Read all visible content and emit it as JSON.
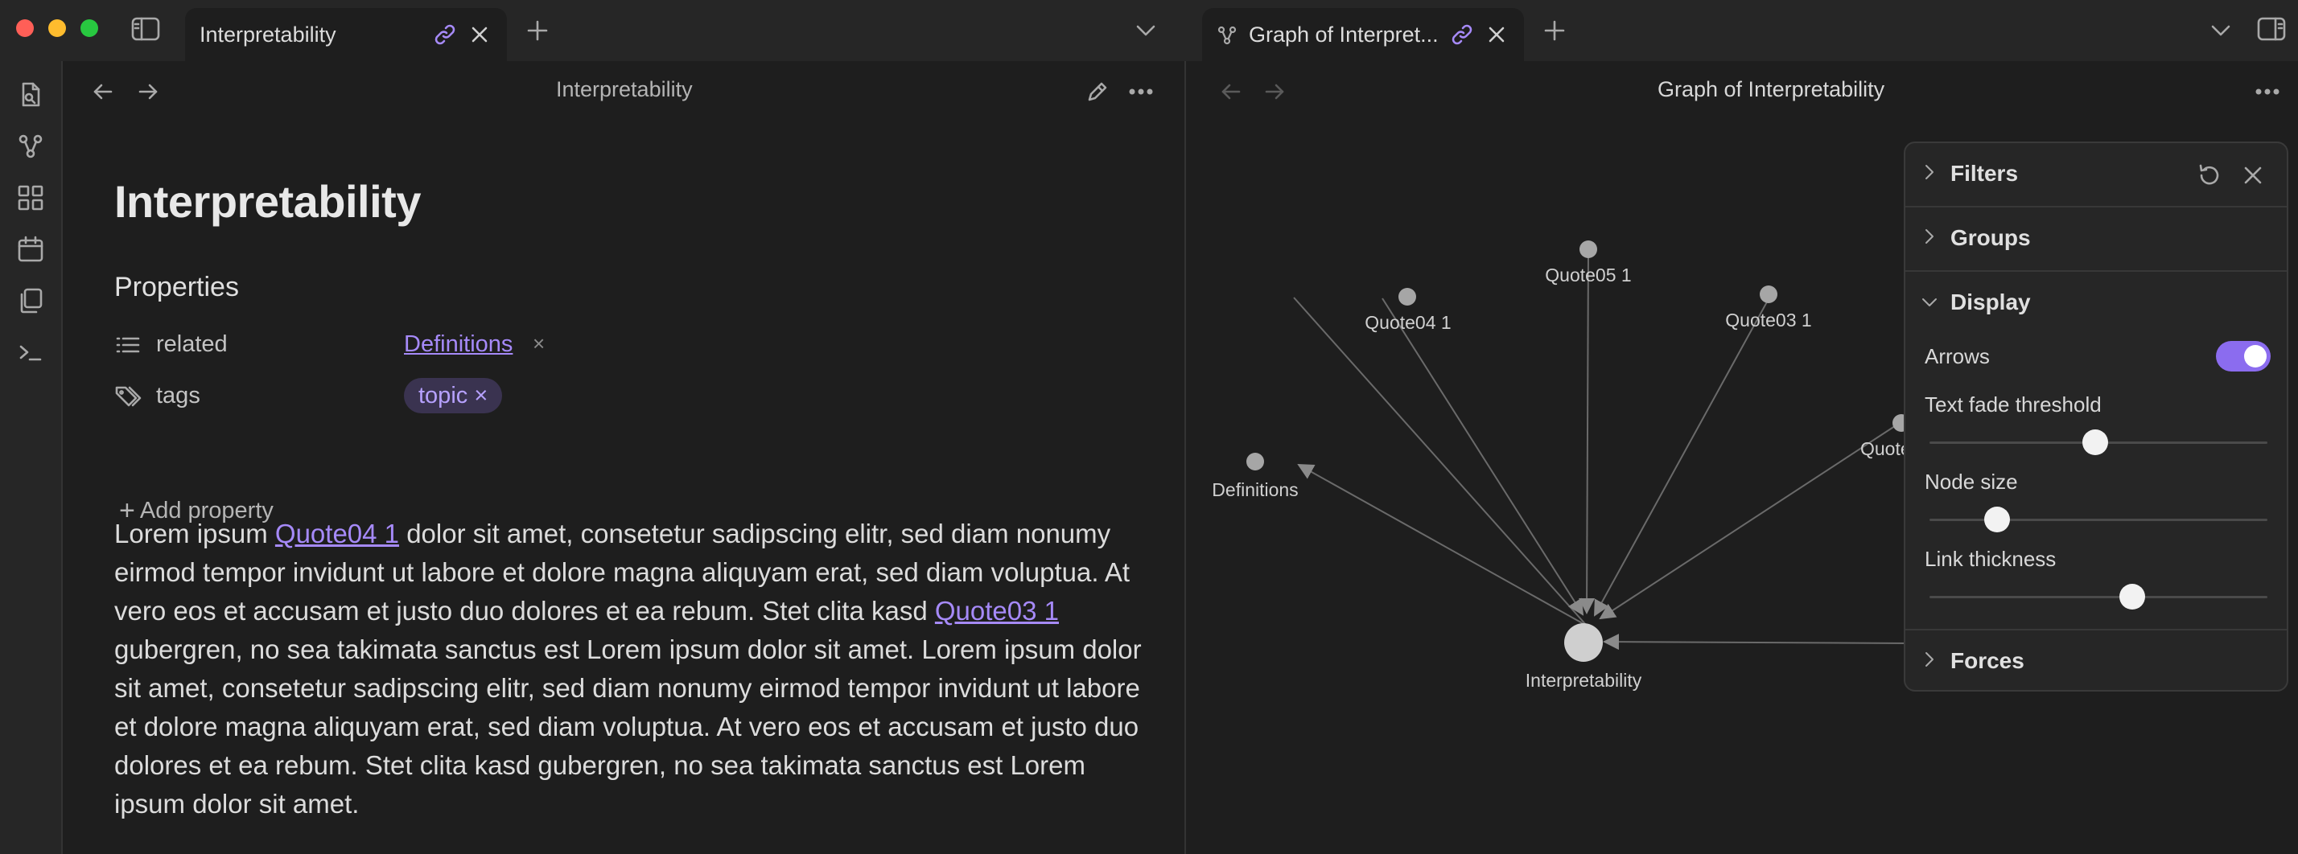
{
  "tabs": {
    "left": {
      "title": "Interpretability"
    },
    "right": {
      "title": "Graph of Interpret..."
    }
  },
  "left_pane": {
    "header_title": "Interpretability",
    "note_title": "Interpretability",
    "properties_heading": "Properties",
    "properties": [
      {
        "key": "related",
        "value": "Definitions",
        "icon": "list-icon"
      },
      {
        "key": "tags",
        "value": "topic",
        "icon": "tags-icon"
      }
    ],
    "add_property_label": "Add property",
    "body": {
      "t1": "Lorem ipsum ",
      "link1": "Quote04 1",
      "t2": " dolor sit amet, consetetur sadipscing elitr, sed diam nonumy eirmod tempor invidunt ut labore et dolore magna aliquyam erat, sed diam voluptua. At vero eos et accusam et justo duo dolores et ea rebum. Stet clita kasd ",
      "link2": "Quote03 1",
      "t3": " gubergren, no sea takimata sanctus est Lorem ipsum dolor sit amet. Lorem ipsum dolor sit amet, consetetur sadipscing elitr, sed diam nonumy eirmod tempor invidunt ut labore et dolore magna aliquyam erat, sed diam voluptua. At vero eos et accusam et justo duo dolores et ea rebum. Stet clita kasd gubergren, no sea takimata sanctus est Lorem ipsum dolor sit amet."
    }
  },
  "right_pane": {
    "header_title": "Graph of Interpretability",
    "graph": {
      "nodes": [
        "Quote05 1",
        "Quote04 1",
        "Quote03 1",
        "Definitions",
        "Quote",
        "Interpretability"
      ]
    },
    "panel": {
      "filters": "Filters",
      "groups": "Groups",
      "display": "Display",
      "arrows": "Arrows",
      "arrows_on": true,
      "text_fade_threshold": "Text fade threshold",
      "text_fade_value": 0.5,
      "node_size": "Node size",
      "node_size_value": 0.2,
      "link_thickness": "Link thickness",
      "link_thickness_value": 0.62,
      "forces": "Forces"
    }
  },
  "colors": {
    "accent": "#a68af9",
    "toggle": "#8b6cef",
    "background": "#1e1e1e",
    "chrome": "#262626"
  }
}
